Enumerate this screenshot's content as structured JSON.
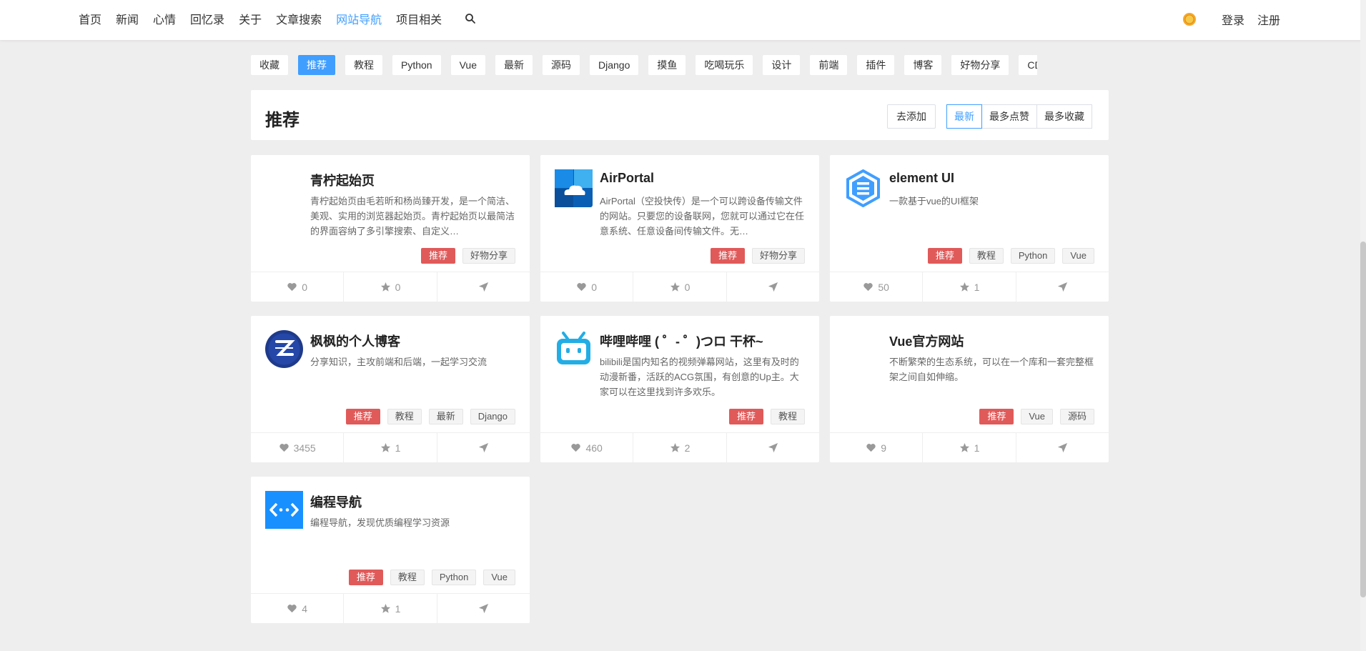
{
  "nav": {
    "items": [
      "首页",
      "新闻",
      "心情",
      "回忆录",
      "关于",
      "文章搜索",
      "网站导航",
      "项目相关"
    ],
    "active": "网站导航",
    "login": "登录",
    "register": "注册"
  },
  "categories": [
    "收藏",
    "推荐",
    "教程",
    "Python",
    "Vue",
    "最新",
    "源码",
    "Django",
    "摸鱼",
    "吃喝玩乐",
    "设计",
    "前端",
    "插件",
    "博客",
    "好物分享",
    "CDN分享"
  ],
  "active_category": "推荐",
  "header": {
    "title": "推荐",
    "add_label": "去添加",
    "sort": [
      "最新",
      "最多点赞",
      "最多收藏"
    ],
    "sort_active": "最新"
  },
  "colors": {
    "accent": "#409eff",
    "tag_rec": "#e05a5a"
  },
  "cards": [
    {
      "title": "青柠起始页",
      "desc": "青柠起始页由毛若昕和杨尚臻开发，是一个简洁、美观、实用的浏览器起始页。青柠起始页以最简洁的界面容纳了多引擎搜索、自定义…",
      "tags": [
        "推荐",
        "好物分享"
      ],
      "likes": "0",
      "stars": "0",
      "logo": "blank"
    },
    {
      "title": "AirPortal",
      "desc": "AirPortal（空投快传）是一个可以跨设备传输文件的网站。只要您的设备联网，您就可以通过它在任意系统、任意设备间传输文件。无…",
      "tags": [
        "推荐",
        "好物分享"
      ],
      "likes": "0",
      "stars": "0",
      "logo": "cloud-logo"
    },
    {
      "title": "element UI",
      "desc": "一款基于vue的UI框架",
      "tags": [
        "推荐",
        "教程",
        "Python",
        "Vue"
      ],
      "likes": "50",
      "stars": "1",
      "logo": "element-logo"
    },
    {
      "title": "枫枫的个人博客",
      "desc": "分享知识，主攻前端和后端，一起学习交流",
      "tags": [
        "推荐",
        "教程",
        "最新",
        "Django"
      ],
      "likes": "3455",
      "stars": "1",
      "logo": "blog-logo"
    },
    {
      "title": "哔哩哔哩 ( ゜- ゜)つロ 干杯~",
      "desc": "bilibili是国内知名的视频弹幕网站，这里有及时的动漫新番，活跃的ACG氛围，有创意的Up主。大家可以在这里找到许多欢乐。",
      "tags": [
        "推荐",
        "教程"
      ],
      "likes": "460",
      "stars": "2",
      "logo": "bilibili-logo"
    },
    {
      "title": "Vue官方网站",
      "desc": "不断繁荣的生态系统，可以在一个库和一套完整框架之间自如伸缩。",
      "tags": [
        "推荐",
        "Vue",
        "源码"
      ],
      "likes": "9",
      "stars": "1",
      "logo": "blank"
    },
    {
      "title": "编程导航",
      "desc": "编程导航，发现优质编程学习资源",
      "tags": [
        "推荐",
        "教程",
        "Python",
        "Vue"
      ],
      "likes": "4",
      "stars": "1",
      "logo": "code-nav-logo"
    }
  ]
}
